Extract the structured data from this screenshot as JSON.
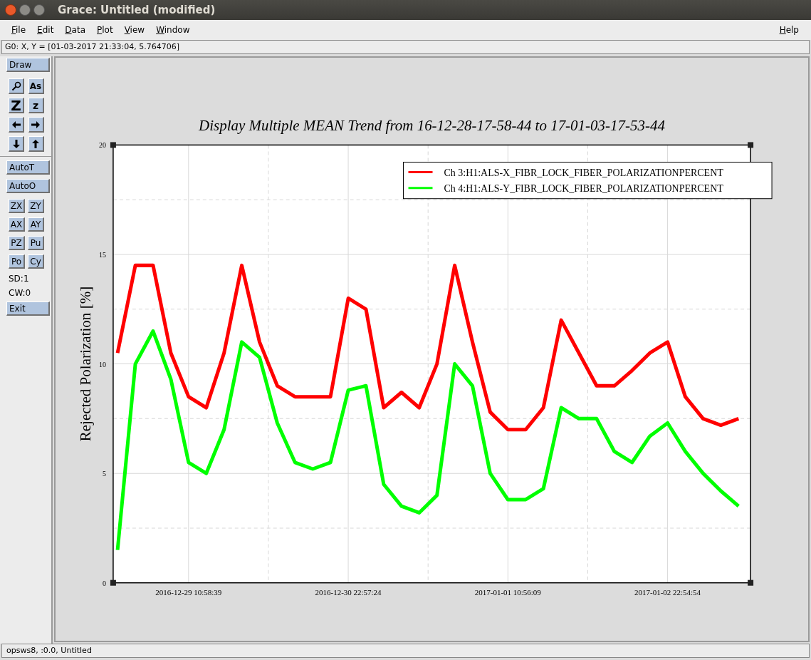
{
  "window": {
    "title": "Grace: Untitled (modified)"
  },
  "menu": [
    {
      "label": "File"
    },
    {
      "label": "Edit"
    },
    {
      "label": "Data"
    },
    {
      "label": "Plot"
    },
    {
      "label": "View"
    },
    {
      "label": "Window"
    }
  ],
  "help_menu": {
    "label": "Help"
  },
  "locator": "G0: X, Y = [01-03-2017 21:33:04, 5.764706]",
  "toolbar": {
    "draw": "Draw",
    "tools": [
      {
        "kind": "magnify"
      },
      {
        "kind": "label",
        "label": "As"
      },
      {
        "kind": "label",
        "label": "Z"
      },
      {
        "kind": "label",
        "label": "z"
      },
      {
        "kind": "left"
      },
      {
        "kind": "right"
      },
      {
        "kind": "down"
      },
      {
        "kind": "up"
      }
    ],
    "auto_buttons": [
      "AutoT",
      "AutoO"
    ],
    "small_buttons": [
      "ZX",
      "ZY",
      "AX",
      "AY",
      "PZ",
      "Pu",
      "Po",
      "Cy"
    ],
    "readouts": [
      "SD:1",
      "CW:0"
    ],
    "exit": "Exit"
  },
  "chart_data": {
    "type": "line",
    "title": "Display Multiple MEAN Trend from 16-12-28-17-58-44 to 17-01-03-17-53-44",
    "ylabel": "Rejected Polarization [%]",
    "categories": [
      null,
      null,
      null,
      null,
      "2016-12-29 10:58:39",
      null,
      null,
      null,
      null,
      null,
      null,
      null,
      null,
      "2016-12-30 22:57:24",
      null,
      null,
      null,
      null,
      null,
      null,
      null,
      null,
      "2017-01-01 10:56:09",
      null,
      null,
      null,
      null,
      null,
      null,
      null,
      null,
      "2017-01-02 22:54:54",
      null,
      null,
      null,
      null
    ],
    "series": [
      {
        "name": "Ch 3:H1:ALS-X_FIBR_LOCK_FIBER_POLARIZATIONPERCENT",
        "color": "#ff0000",
        "values": [
          10.5,
          14.5,
          14.5,
          10.5,
          8.5,
          8,
          10.5,
          14.5,
          11,
          9,
          8.5,
          8.5,
          8.5,
          13,
          12.5,
          8,
          8.7,
          8,
          10,
          14.5,
          11,
          7.8,
          7,
          7,
          8,
          12,
          10.5,
          9,
          9,
          9.7,
          10.5,
          11,
          8.5,
          7.5,
          7.2,
          7.5
        ]
      },
      {
        "name": "Ch 4:H1:ALS-Y_FIBR_LOCK_FIBER_POLARIZATIONPERCENT",
        "color": "#00ff00",
        "values": [
          1.5,
          10,
          11.5,
          9.3,
          5.5,
          5,
          7,
          11,
          10.3,
          7.3,
          5.5,
          5.2,
          5.5,
          8.8,
          9,
          4.5,
          3.5,
          3.2,
          4,
          10,
          9,
          5,
          3.8,
          3.8,
          4.3,
          8,
          7.5,
          7.5,
          6,
          5.5,
          6.7,
          7.3,
          6,
          5,
          4.2,
          3.5
        ]
      }
    ],
    "grid": true,
    "legend": "upper right",
    "ylim": [
      0,
      20
    ],
    "yticks": [
      0,
      5,
      10,
      15,
      20
    ]
  },
  "status_bar": "opsws8, :0.0, Untitled"
}
